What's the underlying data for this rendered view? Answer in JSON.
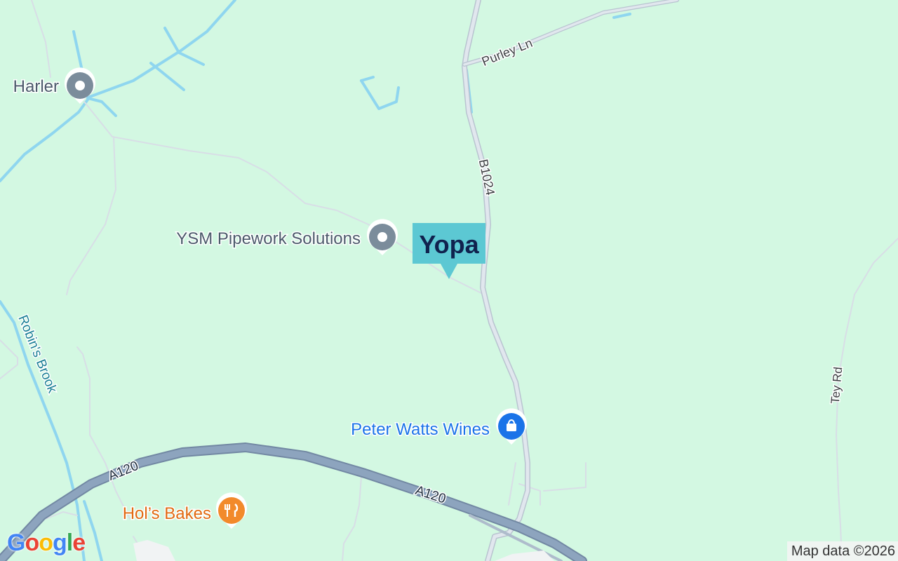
{
  "map": {
    "places": {
      "harler": "Harler",
      "ysm": "YSM Pipework Solutions",
      "peter_watts": "Peter Watts Wines",
      "hols_bakes": "Hol’s Bakes"
    },
    "roads": {
      "purley_ln": "Purley Ln",
      "b1024": "B1024",
      "a120_left": "A120",
      "a120_right": "A120",
      "tey_rd": "Tey Rd"
    },
    "water": {
      "robins_brook": "Robin's Brook"
    },
    "marker": {
      "brand_text": "Yopa"
    },
    "attribution": "Map data ©2026",
    "logo": {
      "letters": [
        "G",
        "o",
        "o",
        "g",
        "l",
        "e"
      ]
    },
    "colors": {
      "land": "#d3f8e2",
      "water": "#8fd6ef",
      "minor_road": "#d8dee6",
      "major_road": "#8da4be",
      "generic_poi": "#7b8c9b",
      "shop_poi": "#1a73e8",
      "food_poi": "#f28a2b",
      "marker_bg": "#5cc8d3",
      "marker_text": "#10224e"
    },
    "icons": {
      "generic_poi": "pin-icon",
      "shop_poi": "shopping-bag-icon",
      "food_poi": "cutlery-icon"
    }
  }
}
